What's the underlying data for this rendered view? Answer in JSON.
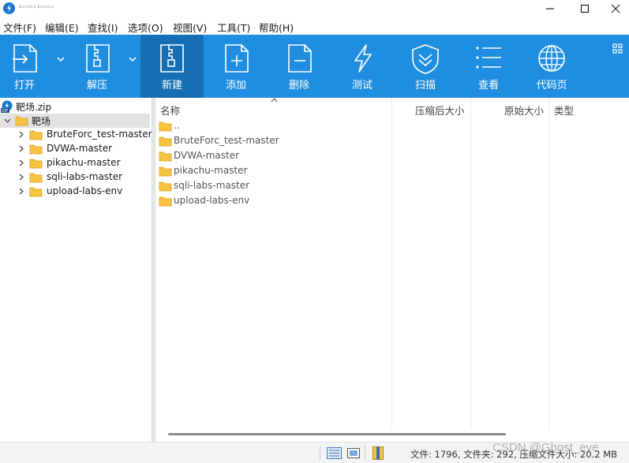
{
  "window": {
    "title_small": "BandiZip Bandizip"
  },
  "menu": [
    {
      "label": "文件(F)"
    },
    {
      "label": "编辑(E)"
    },
    {
      "label": "查找(I)"
    },
    {
      "label": "选项(O)"
    },
    {
      "label": "视图(V)"
    },
    {
      "label": "工具(T)"
    },
    {
      "label": "帮助(H)"
    }
  ],
  "toolbar": {
    "open": "打开",
    "extract": "解压",
    "new": "新建",
    "add": "添加",
    "delete": "删除",
    "test": "测试",
    "scan": "扫描",
    "view": "查看",
    "codepage": "代码页"
  },
  "tree": {
    "archive": "靶场.zip",
    "root": "靶场",
    "children": [
      "BruteForc_test-master",
      "DVWA-master",
      "pikachu-master",
      "sqli-labs-master",
      "upload-labs-env"
    ]
  },
  "list": {
    "columns": {
      "name": "名称",
      "compressed": "压缩后大小",
      "original": "原始大小",
      "type": "类型"
    },
    "rows": [
      "..",
      "BruteForc_test-master",
      "DVWA-master",
      "pikachu-master",
      "sqli-labs-master",
      "upload-labs-env"
    ]
  },
  "status": {
    "text": "文件: 1796, 文件夹: 292, 压缩文件大小: 20.2 MB"
  },
  "watermark": "CSDN @Ghost_eye",
  "colors": {
    "toolbar": "#1f8ee0",
    "toolbar_active": "#166fb5",
    "folder": "#f5c242"
  }
}
